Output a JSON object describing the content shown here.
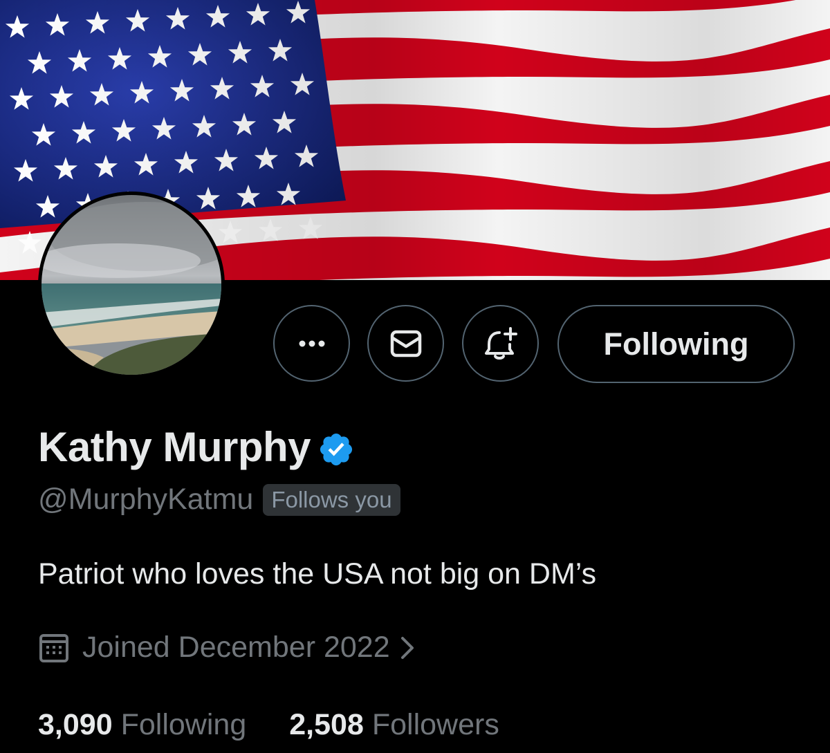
{
  "profile": {
    "display_name": "Kathy Murphy",
    "handle": "@MurphyKatmu",
    "follows_you_badge": "Follows you",
    "bio": "Patriot who loves the USA not big on DM’s",
    "joined": "Joined December 2022",
    "verified": true
  },
  "actions": {
    "more_icon": "more-horizontal-icon",
    "message_icon": "envelope-icon",
    "notify_icon": "bell-plus-icon",
    "following_label": "Following"
  },
  "stats": {
    "following_count": "3,090",
    "following_label": "Following",
    "followers_count": "2,508",
    "followers_label": "Followers"
  },
  "colors": {
    "background": "#000000",
    "text_primary": "#e7e9ea",
    "text_secondary": "#71767b",
    "border": "#536471",
    "verified_blue": "#1d9bf0",
    "flag_red": "#d0021b",
    "flag_blue": "#1c2f8c"
  }
}
